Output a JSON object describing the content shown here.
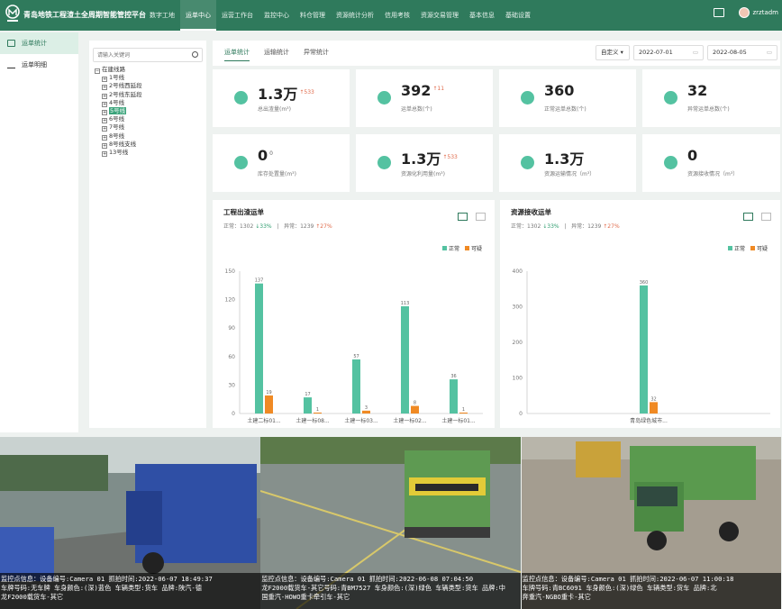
{
  "header": {
    "title": "青岛地铁工程渣土全周期智能管控平台",
    "nav": [
      "数字工地",
      "运单中心",
      "运营工作台",
      "监控中心",
      "料仓管理",
      "资源统计分析",
      "信用考核",
      "资源交易管理",
      "基本信息",
      "基础设置"
    ],
    "active_nav": 1,
    "user": "zrztadm"
  },
  "leftnav": {
    "items": [
      "运单统计",
      "运单明细"
    ]
  },
  "tree": {
    "search_placeholder": "请输入关键词",
    "root": "在建线路",
    "children": [
      "1号线",
      "2号线西延段",
      "2号线东延段",
      "4号线",
      "5号线",
      "6号线",
      "7号线",
      "8号线",
      "8号线支线",
      "13号线"
    ],
    "selected": 4
  },
  "tabs": [
    "运单统计",
    "运输统计",
    "异常统计"
  ],
  "filters": {
    "mode": "自定义",
    "start_date": "2022-07-01",
    "end_date": "2022-08-05"
  },
  "cards": [
    {
      "value": "1.3万",
      "delta": "↑533",
      "label": "总出渣量(m³)",
      "color": "#54c2a1"
    },
    {
      "value": "392",
      "delta": "↑11",
      "label": "运单总数(个)",
      "color": "#54c2a1"
    },
    {
      "value": "360",
      "delta": "",
      "label": "正常运单总数(个)",
      "color": "#54c2a1"
    },
    {
      "value": "32",
      "delta": "",
      "label": "异常运单总数(个)",
      "color": "#54c2a1"
    },
    {
      "value": "0",
      "delta": "0",
      "label": "库存处置量(m³)",
      "color": "#54c2a1"
    },
    {
      "value": "1.3万",
      "delta": "↑533",
      "label": "资源化利用量(m³)",
      "color": "#54c2a1"
    },
    {
      "value": "1.3万",
      "delta": "",
      "label": "资源运输情况（m³）",
      "color": "#54c2a1"
    },
    {
      "value": "0",
      "delta": "",
      "label": "资源接收情况（m³）",
      "color": "#54c2a1"
    }
  ],
  "panels": [
    {
      "title": "工程出渣运单",
      "normal_label": "正常：",
      "normal": "1302",
      "normal_delta": "↓33%",
      "abnormal_label": "异常：",
      "abnormal": "1239",
      "abnormal_delta": "↑27%",
      "legend_normal": "正常",
      "legend_suspicious": "可疑"
    },
    {
      "title": "资源接收运单",
      "normal_label": "正常：",
      "normal": "1302",
      "normal_delta": "↓33%",
      "abnormal_label": "异常：",
      "abnormal": "1239",
      "abnormal_delta": "↑27%",
      "legend_normal": "正常",
      "legend_suspicious": "可疑"
    }
  ],
  "chart_data": [
    {
      "type": "bar",
      "categories": [
        "土建二标01...",
        "土建一标08...",
        "土建一标03...",
        "土建一标02...",
        "土建一标01..."
      ],
      "series": [
        {
          "name": "正常",
          "values": [
            137,
            17,
            57,
            113,
            36
          ],
          "color": "#54c2a1"
        },
        {
          "name": "可疑",
          "values": [
            19,
            1,
            3,
            8,
            1
          ],
          "color": "#f08a24"
        }
      ],
      "ylim": [
        0,
        150
      ],
      "yticks": [
        0,
        30,
        60,
        90,
        120,
        150
      ],
      "legend": "top-right",
      "grid": false
    },
    {
      "type": "bar",
      "categories": [
        "青岛绿色城市..."
      ],
      "series": [
        {
          "name": "正常",
          "values": [
            360
          ],
          "color": "#54c2a1"
        },
        {
          "name": "可疑",
          "values": [
            32
          ],
          "color": "#f08a24"
        }
      ],
      "ylim": [
        0,
        400
      ],
      "yticks": [
        0,
        100,
        200,
        300,
        400
      ],
      "legend": "top-right",
      "grid": false
    }
  ],
  "cameras": [
    {
      "line1": "监控点信息：设备编号:Camera 01 抓拍时间:2022-06-07 18:49:37",
      "line2": "车牌号码:无车牌 车身颜色:(深)蓝色 车辆类型:货车 品牌:陕汽-德",
      "line3": "龙F2000载货车-其它"
    },
    {
      "line1": "监控点信息：设备编号:Camera 01 抓拍时间:2022-06-08 07:04:50",
      "line2": "龙F2000载货车-其它号码:青BM7527 车身颜色:(深)绿色 车辆类型:货车 品牌:中",
      "line3": "国重汽-HOWO重卡牵引车-其它"
    },
    {
      "line1": "监控点信息：设备编号:Camera 01 抓拍时间:2022-06-07 11:00:18",
      "line2": "车牌号码:青BC6091 车身颜色:(深)绿色 车辆类型:货车 品牌:北",
      "line3": "奔重汽-NGBO重卡-其它"
    }
  ]
}
